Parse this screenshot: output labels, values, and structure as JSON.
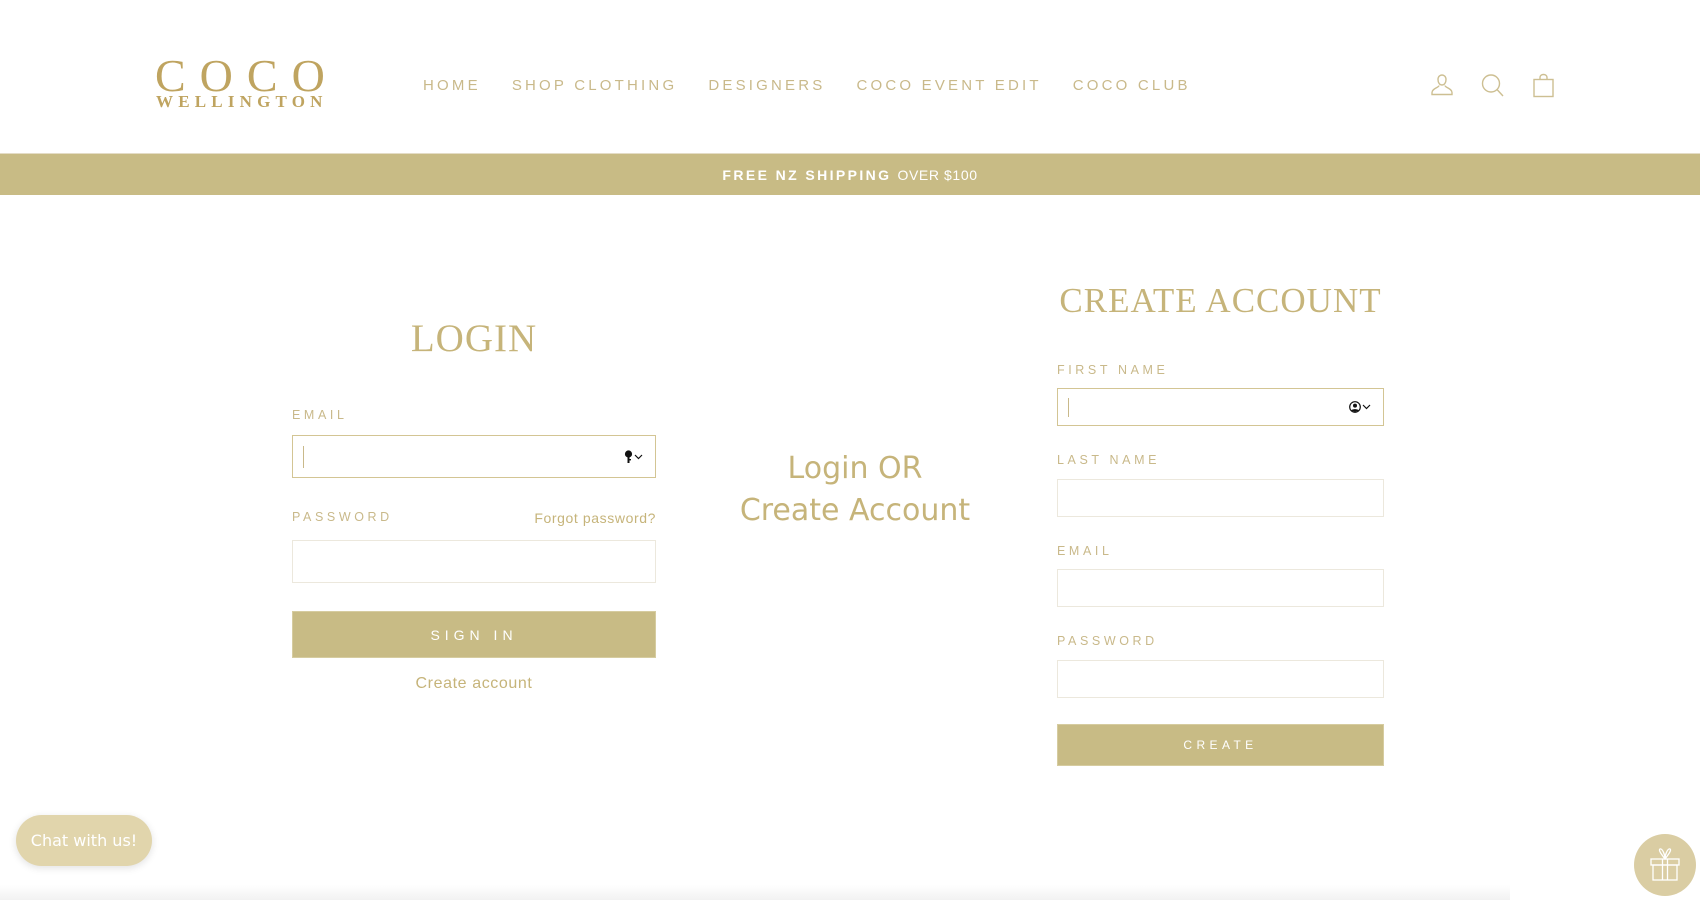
{
  "header": {
    "logo": {
      "line1": "COCO",
      "line2": "WELLINGTON"
    },
    "nav": [
      {
        "label": "HOME"
      },
      {
        "label": "SHOP CLOTHING"
      },
      {
        "label": "DESIGNERS"
      },
      {
        "label": "COCO EVENT EDIT"
      },
      {
        "label": "COCO CLUB"
      }
    ],
    "icons": {
      "account": "account-icon",
      "search": "search-icon",
      "cart": "cart-icon"
    }
  },
  "announcement": {
    "bold": "FREE NZ SHIPPING",
    "regular": "OVER $100"
  },
  "login": {
    "title": "LOGIN",
    "email_label": "EMAIL",
    "email_value": "",
    "password_label": "PASSWORD",
    "password_value": "",
    "forgot_password": "Forgot password?",
    "sign_in_button": "SIGN IN",
    "create_account_link": "Create account"
  },
  "divider_text": {
    "line1": "Login OR",
    "line2": "Create Account"
  },
  "create_account": {
    "title": "CREATE ACCOUNT",
    "first_name_label": "FIRST NAME",
    "first_name_value": "",
    "last_name_label": "LAST NAME",
    "last_name_value": "",
    "email_label": "EMAIL",
    "email_value": "",
    "password_label": "PASSWORD",
    "password_value": "",
    "create_button": "CREATE"
  },
  "chat": {
    "label": "Chat with us!"
  },
  "colors": {
    "brand_gold": "#c8bb85",
    "text_gold": "#c6b47a",
    "logo_gold": "#bfa460",
    "chat_bg": "#e1d5ac"
  }
}
